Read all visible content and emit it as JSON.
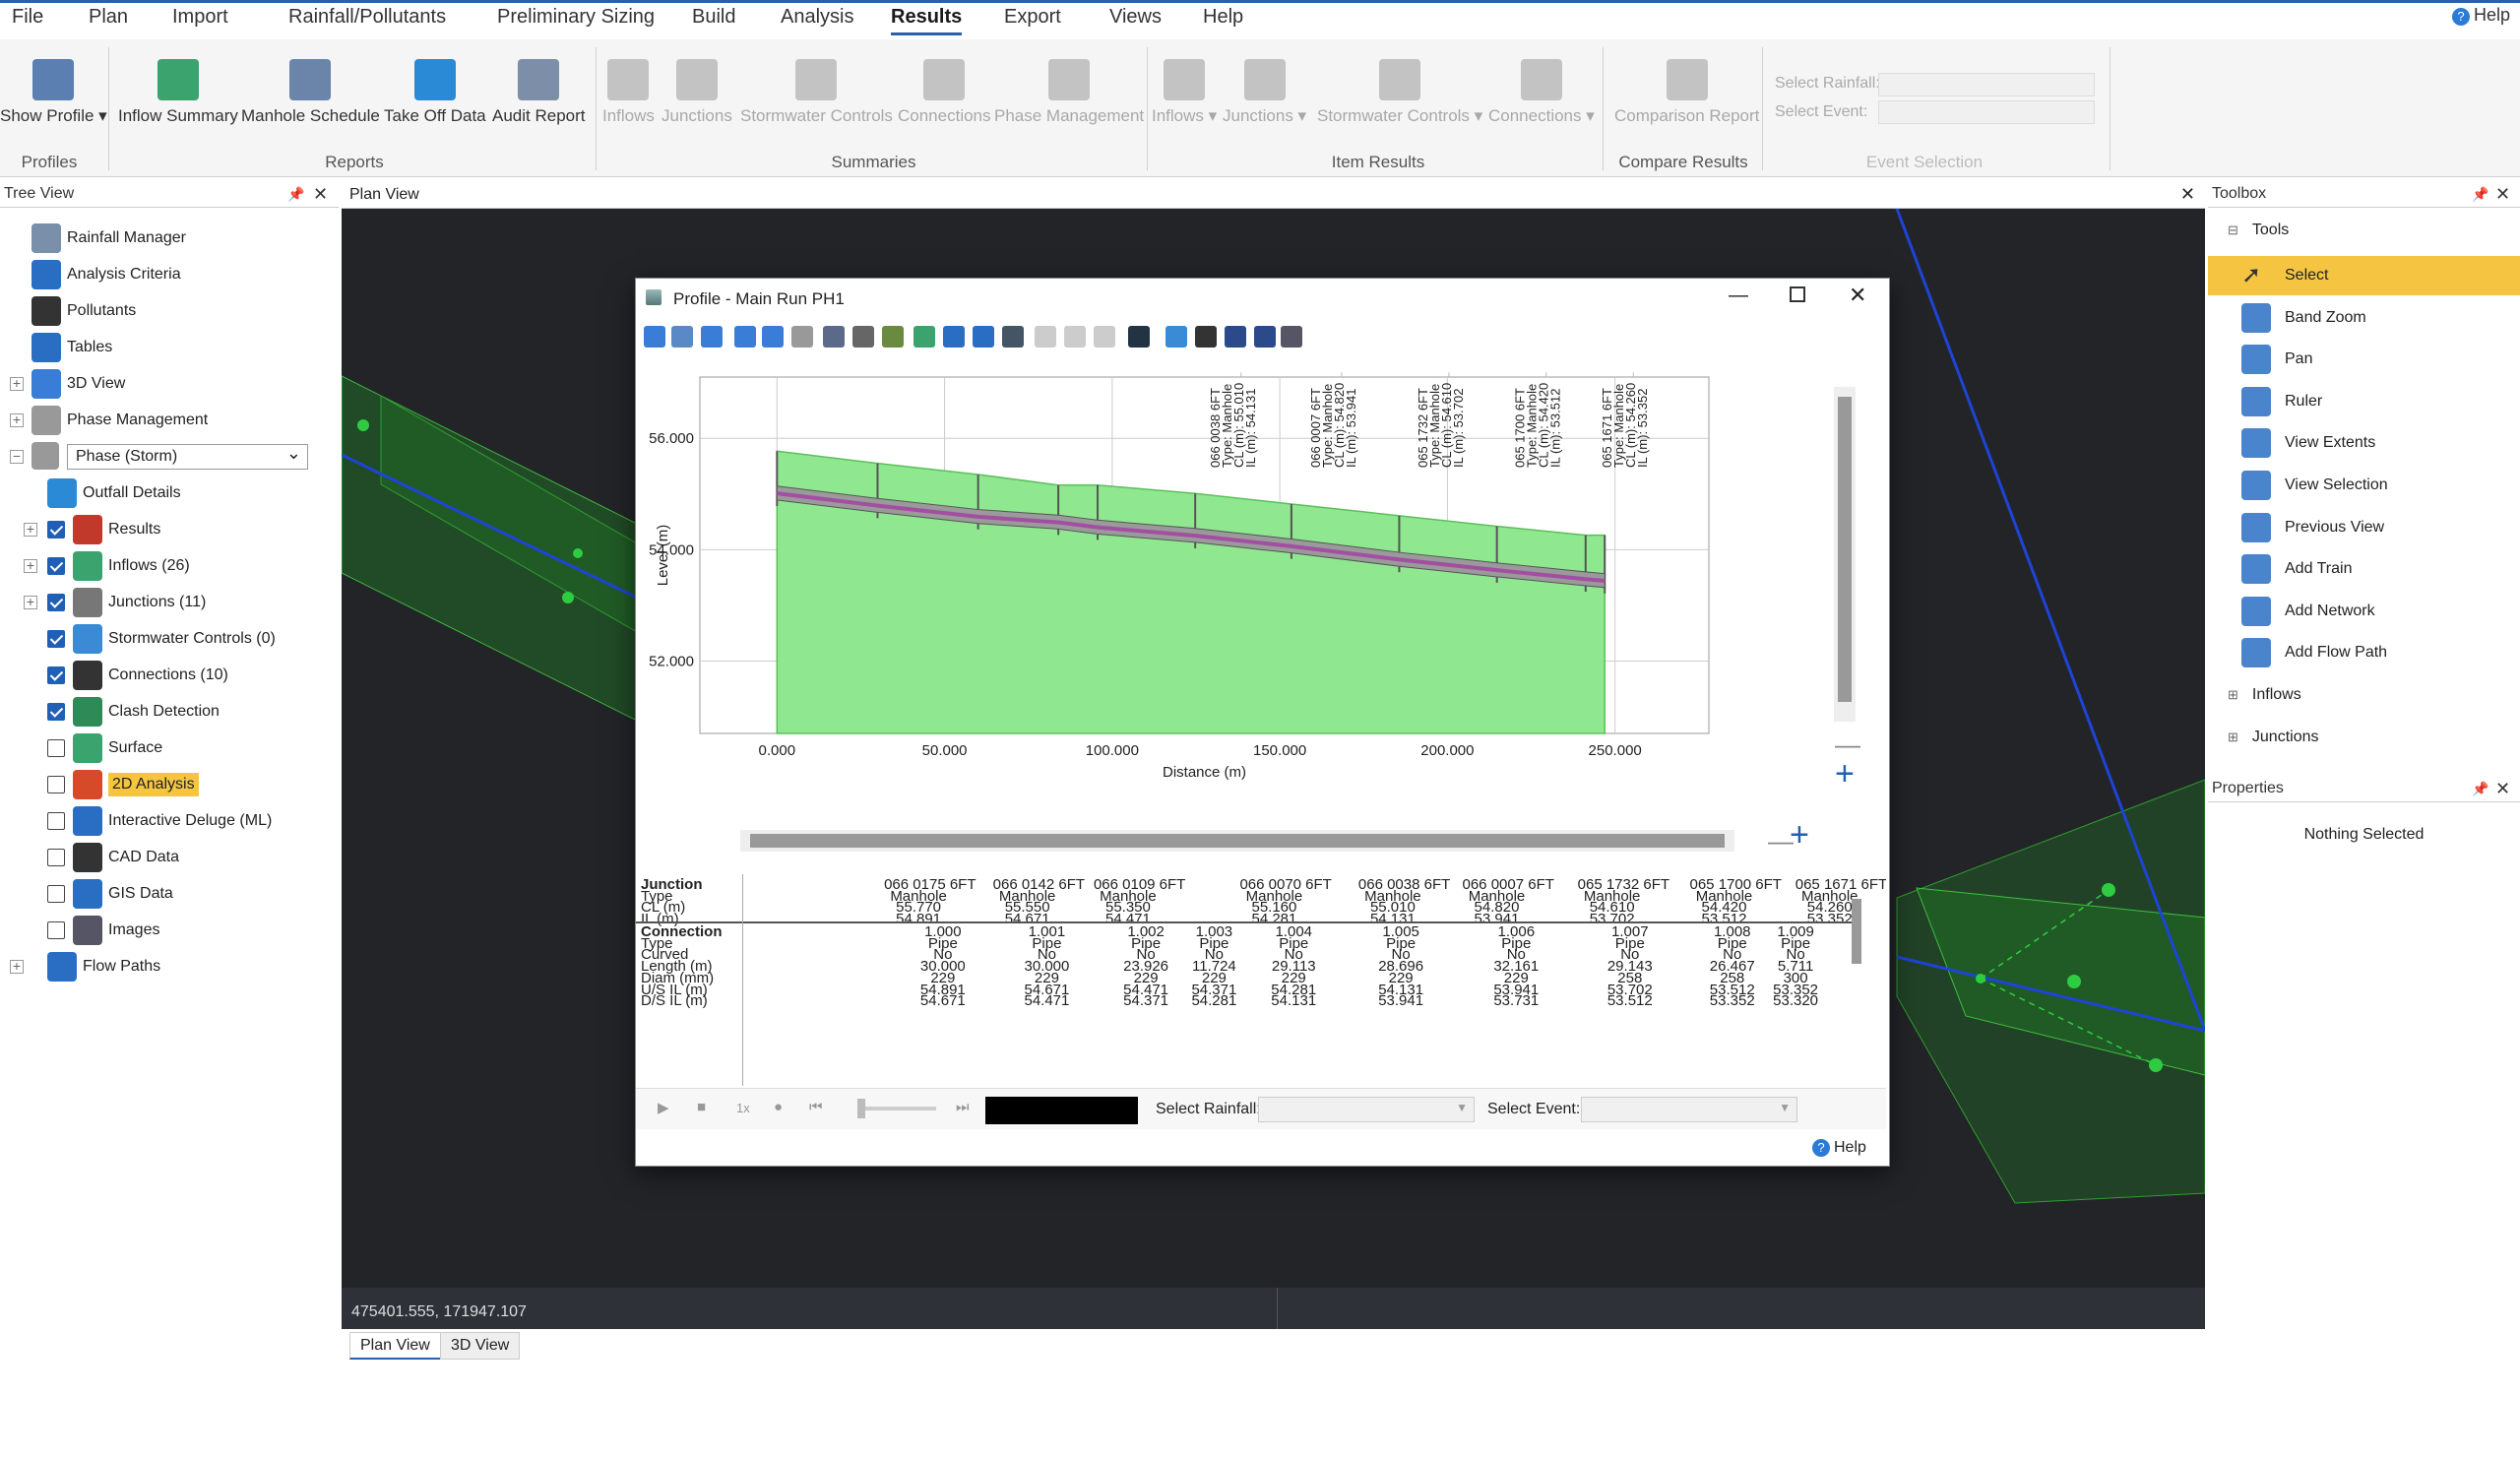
{
  "menu": {
    "items": [
      "File",
      "Plan",
      "Import",
      "Rainfall/Pollutants",
      "Preliminary Sizing",
      "Build",
      "Analysis",
      "Results",
      "Export",
      "Views",
      "Help"
    ],
    "active": "Results",
    "help": "Help"
  },
  "ribbon": {
    "buttons": [
      {
        "label": "Show Profile ▾",
        "icon": "profile-icon",
        "enabled": true
      },
      {
        "label": "Inflow Summary",
        "icon": "inflow-summary-icon",
        "enabled": true
      },
      {
        "label": "Manhole Schedule",
        "icon": "manhole-schedule-icon",
        "enabled": true
      },
      {
        "label": "Take Off Data",
        "icon": "cart-icon",
        "enabled": true
      },
      {
        "label": "Audit Report",
        "icon": "report-icon",
        "enabled": true
      },
      {
        "label": "Inflows",
        "icon": "sum-icon",
        "enabled": false
      },
      {
        "label": "Junctions",
        "icon": "sum-icon",
        "enabled": false
      },
      {
        "label": "Stormwater Controls",
        "icon": "sum-icon",
        "enabled": false
      },
      {
        "label": "Connections",
        "icon": "sum-icon",
        "enabled": false
      },
      {
        "label": "Phase Management",
        "icon": "chart-icon",
        "enabled": false
      },
      {
        "label": "Inflows ▾",
        "icon": "chart-icon",
        "enabled": false
      },
      {
        "label": "Junctions ▾",
        "icon": "chart-icon",
        "enabled": false
      },
      {
        "label": "Stormwater Controls ▾",
        "icon": "chart-icon",
        "enabled": false
      },
      {
        "label": "Connections ▾",
        "icon": "chart-icon",
        "enabled": false
      },
      {
        "label": "Comparison Report",
        "icon": "compare-icon",
        "enabled": false
      }
    ],
    "groups": [
      "Profiles",
      "Reports",
      "Summaries",
      "Item Results",
      "Compare Results",
      "Event Selection"
    ],
    "select_rainfall": "Select Rainfall:",
    "select_event": "Select Event:"
  },
  "tree": {
    "title": "Tree View",
    "items": [
      {
        "label": "Rainfall Manager",
        "icon": "rainfall-icon"
      },
      {
        "label": "Analysis Criteria",
        "icon": "criteria-icon"
      },
      {
        "label": "Pollutants",
        "icon": "pollutants-icon"
      },
      {
        "label": "Tables",
        "icon": "table-icon"
      },
      {
        "label": "3D View",
        "icon": "3d-icon"
      },
      {
        "label": "Phase Management",
        "icon": "phase-icon"
      },
      {
        "label": "Phase (Storm)",
        "icon": "phase-icon"
      },
      {
        "label": "Outfall Details",
        "icon": "outfall-icon"
      },
      {
        "label": "Results",
        "icon": "results-icon",
        "checked": true
      },
      {
        "label": "Inflows (26)",
        "icon": "inflows-icon",
        "checked": true
      },
      {
        "label": "Junctions (11)",
        "icon": "junctions-icon",
        "checked": true
      },
      {
        "label": "Stormwater Controls (0)",
        "icon": "stormwater-icon",
        "checked": true
      },
      {
        "label": "Connections (10)",
        "icon": "connections-icon",
        "checked": true
      },
      {
        "label": "Clash Detection",
        "icon": "clash-icon",
        "checked": true
      },
      {
        "label": "Surface",
        "icon": "surface-icon",
        "checked": false
      },
      {
        "label": "2D Analysis",
        "icon": "2d-analysis-icon",
        "checked": false
      },
      {
        "label": "Interactive Deluge (ML)",
        "icon": "deluge-icon",
        "checked": false
      },
      {
        "label": "CAD Data",
        "icon": "cad-icon",
        "checked": false
      },
      {
        "label": "GIS Data",
        "icon": "gis-icon",
        "checked": false
      },
      {
        "label": "Images",
        "icon": "images-icon",
        "checked": false
      },
      {
        "label": "Flow Paths",
        "icon": "flowpaths-icon"
      }
    ]
  },
  "plan": {
    "title": "Plan View",
    "coords": "475401.555, 171947.107",
    "tabs": [
      "Plan View",
      "3D View"
    ]
  },
  "toolbox": {
    "title": "Toolbox",
    "section": "Tools",
    "tools": [
      "Select",
      "Band Zoom",
      "Pan",
      "Ruler",
      "View Extents",
      "View Selection",
      "Previous View",
      "Add Train",
      "Add Network",
      "Add Flow Path"
    ],
    "selected": "Select",
    "groups": [
      "Inflows",
      "Junctions"
    ]
  },
  "properties": {
    "title": "Properties",
    "empty": "Nothing Selected"
  },
  "dialog": {
    "title": "Profile - Main Run PH1",
    "help": "Help",
    "select_rainfall": "Select Rainfall:",
    "select_event": "Select Event:",
    "speed": "1x"
  },
  "chart_data": {
    "type": "line",
    "title": "",
    "xlabel": "Distance (m)",
    "ylabel": "Level (m)",
    "xlim": [
      -23,
      278
    ],
    "ylim": [
      50.7,
      57.1
    ],
    "x_ticks": [
      "0.000",
      "50.000",
      "100.000",
      "150.000",
      "200.000",
      "250.000"
    ],
    "y_ticks": [
      "52.000",
      "54.000",
      "56.000"
    ],
    "series": [
      {
        "name": "",
        "x": [
          0,
          30,
          60,
          83.926,
          95.65,
          124.763,
          153.459,
          185.62,
          214.763,
          241.23,
          246.941
        ],
        "values": [
          55.77,
          55.55,
          55.35,
          55.16,
          55.16,
          55.01,
          54.82,
          54.61,
          54.42,
          54.26,
          54.26
        ]
      },
      {
        "name": "",
        "x": [
          0,
          30,
          60,
          83.926,
          95.65,
          124.763,
          153.459,
          185.62,
          214.763,
          241.23,
          246.941
        ],
        "values": [
          54.891,
          54.671,
          54.471,
          54.371,
          54.281,
          54.131,
          53.941,
          53.702,
          53.512,
          53.352,
          53.32
        ]
      }
    ],
    "annotations": [
      {
        "x": 132,
        "lines": [
          "066 0038 6FT",
          "Type: Manhole",
          "CL (m): 55.010",
          "IL (m): 54.131"
        ]
      },
      {
        "x": 162,
        "lines": [
          "066 0007 6FT",
          "Type: Manhole",
          "CL (m): 54.820",
          "IL (m): 53.941"
        ]
      },
      {
        "x": 194,
        "lines": [
          "065 1732 6FT",
          "Type: Manhole",
          "CL (m): 54.610",
          "IL (m): 53.702"
        ]
      },
      {
        "x": 223,
        "lines": [
          "065 1700 6FT",
          "Type: Manhole",
          "CL (m): 54.420",
          "IL (m): 53.512"
        ]
      },
      {
        "x": 249,
        "lines": [
          "065 1671 6FT",
          "Type: Manhole",
          "CL (m): 54.260",
          "IL (m): 53.352"
        ]
      }
    ]
  },
  "table": {
    "junction_rows": [
      {
        "label": "Junction",
        "values": [
          "066 0175 6FT",
          "066 0142 6FT",
          "066 0109 6FT",
          "066 0070 6FT",
          "066 0038 6FT",
          "066 0007 6FT",
          "065 1732 6FT",
          "065 1700 6FT",
          "065 1671 6FT"
        ]
      },
      {
        "label": "Type",
        "values": [
          "Manhole",
          "Manhole",
          "Manhole",
          "Manhole",
          "Manhole",
          "Manhole",
          "Manhole",
          "Manhole",
          "Manhole"
        ]
      },
      {
        "label": "CL (m)",
        "values": [
          "55.770",
          "55.550",
          "55.350",
          "55.160",
          "55.010",
          "54.820",
          "54.610",
          "54.420",
          "54.260"
        ]
      },
      {
        "label": "IL (m)",
        "values": [
          "54.891",
          "54.671",
          "54.471",
          "54.281",
          "54.131",
          "53.941",
          "53.702",
          "53.512",
          "53.352"
        ]
      }
    ],
    "connection_rows": [
      {
        "label": "Connection",
        "values": [
          "1.000",
          "1.001",
          "1.002",
          "1.003",
          "1.004",
          "1.005",
          "1.006",
          "1.007",
          "1.008",
          "1.009"
        ]
      },
      {
        "label": "Type",
        "values": [
          "Pipe",
          "Pipe",
          "Pipe",
          "Pipe",
          "Pipe",
          "Pipe",
          "Pipe",
          "Pipe",
          "Pipe",
          "Pipe"
        ]
      },
      {
        "label": "Curved",
        "values": [
          "No",
          "No",
          "No",
          "No",
          "No",
          "No",
          "No",
          "No",
          "No",
          "No"
        ]
      },
      {
        "label": "Length (m)",
        "values": [
          "30.000",
          "30.000",
          "23.926",
          "11.724",
          "29.113",
          "28.696",
          "32.161",
          "29.143",
          "26.467",
          "5.711"
        ]
      },
      {
        "label": "Diam (mm)",
        "values": [
          "229",
          "229",
          "229",
          "229",
          "229",
          "229",
          "229",
          "258",
          "258",
          "300"
        ]
      },
      {
        "label": "U/S IL (m)",
        "values": [
          "54.891",
          "54.671",
          "54.471",
          "54.371",
          "54.281",
          "54.131",
          "53.941",
          "53.702",
          "53.512",
          "53.352"
        ]
      },
      {
        "label": "D/S IL (m)",
        "values": [
          "54.671",
          "54.471",
          "54.371",
          "54.281",
          "54.131",
          "53.941",
          "53.731",
          "53.512",
          "53.352",
          "53.320"
        ]
      }
    ]
  },
  "colors": {
    "accent": "#2b5fa8",
    "ground": "#8fe88f",
    "pipe": "#a24fa2",
    "selected": "#f5c542",
    "map_bg": "#232428"
  }
}
